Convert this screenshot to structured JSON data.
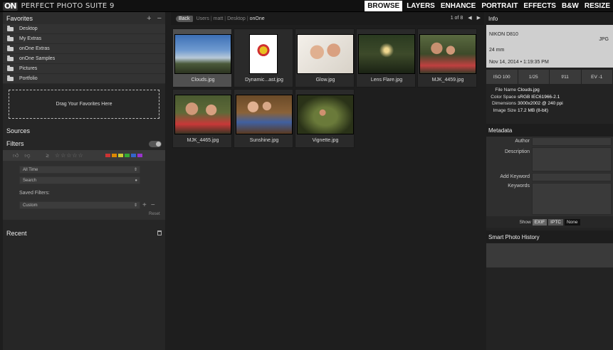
{
  "app": {
    "logo": "ON",
    "title": "PERFECT PHOTO SUITE 9"
  },
  "modules": [
    "BROWSE",
    "LAYERS",
    "ENHANCE",
    "PORTRAIT",
    "EFFECTS",
    "B&W",
    "RESIZE"
  ],
  "favorites": {
    "title": "Favorites",
    "items": [
      "Desktop",
      "My Extras",
      "onOne Extras",
      "onOne Samples",
      "Pictures",
      "Portfolio"
    ],
    "drop_label": "Drag Your Favorites Here"
  },
  "sources": {
    "title": "Sources"
  },
  "filters": {
    "title": "Filters",
    "stars": "☆☆☆☆☆",
    "time_select": "All Time",
    "search_placeholder": "Search",
    "saved_label": "Saved Filters:",
    "saved_select": "Custom",
    "reset": "Reset",
    "color_labels": [
      "#c33",
      "#d80",
      "#cc3",
      "#3a3",
      "#36c",
      "#93c"
    ]
  },
  "recent": {
    "title": "Recent"
  },
  "browser": {
    "back": "Back",
    "path": [
      "Users",
      "matt",
      "Desktop",
      "onOne"
    ],
    "page": "1 of 8"
  },
  "thumbs": [
    {
      "name": "Clouds.jpg",
      "selected": true
    },
    {
      "name": "Dynamic...ast.jpg",
      "selected": false
    },
    {
      "name": "Glow.jpg",
      "selected": false
    },
    {
      "name": "Lens Flare.jpg",
      "selected": false
    },
    {
      "name": "MJK_4459.jpg",
      "selected": false
    },
    {
      "name": "MJK_4465.jpg",
      "selected": false
    },
    {
      "name": "Sunshine.jpg",
      "selected": false
    },
    {
      "name": "Vignette.jpg",
      "selected": false
    }
  ],
  "info": {
    "title": "Info",
    "camera": "NIKON D810",
    "format": "JPG",
    "lens": "24 mm",
    "date": "Nov 14, 2014 • 1:19:35 PM",
    "exif": [
      "ISO 100",
      "1/25",
      "f/11",
      "EV -1"
    ],
    "file": [
      {
        "k": "File Name",
        "v": "Clouds.jpg"
      },
      {
        "k": "Color Space",
        "v": "sRGB IEC61966-2.1"
      },
      {
        "k": "Dimensions",
        "v": "3000x2002 @ 240 ppi"
      },
      {
        "k": "Image Size",
        "v": "17.2 MB (8-bit)"
      }
    ]
  },
  "metadata": {
    "title": "Metadata",
    "labels": {
      "author": "Author",
      "description": "Description",
      "add_keyword": "Add Keyword",
      "keywords": "Keywords"
    },
    "show_label": "Show",
    "show_options": [
      "EXIF",
      "IPTC",
      "None"
    ]
  },
  "history": {
    "title": "Smart Photo History"
  }
}
